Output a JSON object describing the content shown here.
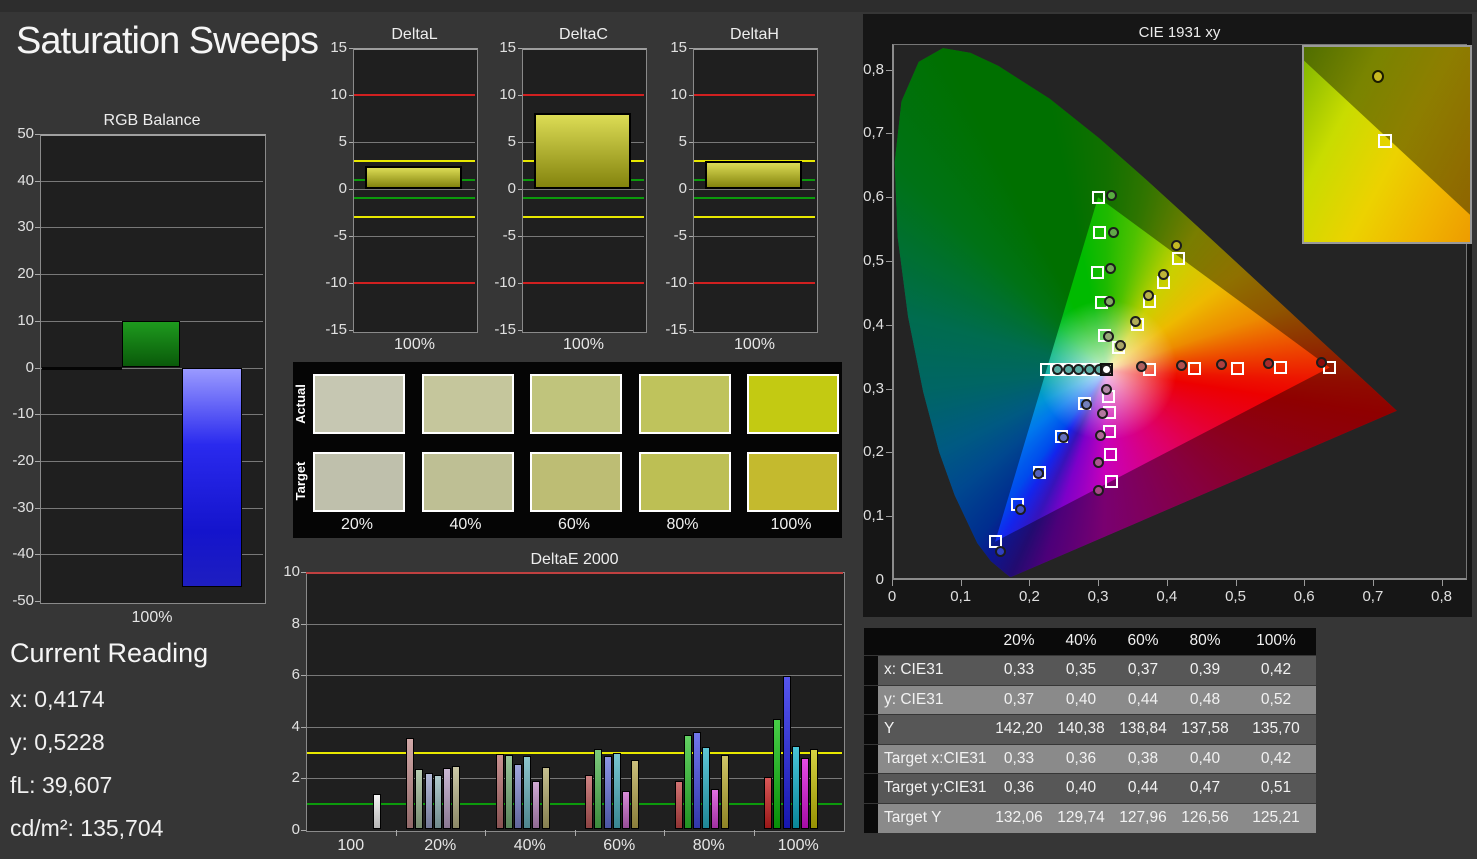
{
  "page": {
    "title": "Saturation Sweeps"
  },
  "current_reading": {
    "heading": "Current Reading",
    "values": [
      {
        "label": "x",
        "value": "0,4174"
      },
      {
        "label": "y",
        "value": "0,5228"
      },
      {
        "label": "fL",
        "value": "39,607"
      },
      {
        "label": "cd/m²",
        "value": "135,704"
      }
    ]
  },
  "chart_data": [
    {
      "id": "rgb_balance",
      "type": "bar",
      "title": "RGB Balance",
      "xlabel": "100%",
      "ylim": [
        -50,
        50
      ],
      "ytick_step": 10,
      "series": [
        {
          "name": "green",
          "value": 10
        },
        {
          "name": "blue",
          "value": -47
        }
      ]
    },
    {
      "id": "delta_l",
      "type": "bar",
      "title": "DeltaL",
      "xlabel": "100%",
      "ylim": [
        -15,
        15
      ],
      "value": 2.4,
      "limit_lines": {
        "red": 10,
        "yellow": 3,
        "green": 1
      }
    },
    {
      "id": "delta_c",
      "type": "bar",
      "title": "DeltaC",
      "xlabel": "100%",
      "ylim": [
        -15,
        15
      ],
      "value": 8.1,
      "limit_lines": {
        "red": 10,
        "yellow": 3,
        "green": 1
      }
    },
    {
      "id": "delta_h",
      "type": "bar",
      "title": "DeltaH",
      "xlabel": "100%",
      "ylim": [
        -15,
        15
      ],
      "value": 2.95,
      "limit_lines": {
        "red": 10,
        "yellow": 3,
        "green": 1
      }
    },
    {
      "id": "saturation_swatches",
      "type": "table",
      "row_labels": [
        "Actual",
        "Target"
      ],
      "columns": [
        "20%",
        "40%",
        "60%",
        "80%",
        "100%"
      ],
      "actual_colors": [
        "#c6c7b2",
        "#c5c69c",
        "#c0c47c",
        "#bfc35c",
        "#c3ca12"
      ],
      "target_colors": [
        "#bfc0ac",
        "#bebf94",
        "#bdbd74",
        "#bdbf54",
        "#c4ba2e"
      ]
    },
    {
      "id": "deltae_2000",
      "type": "bar",
      "title": "DeltaE 2000",
      "ylim": [
        0,
        10
      ],
      "limit_lines": {
        "red": 10,
        "yellow": 3,
        "green": 1
      },
      "groups": [
        {
          "label": "100",
          "bars": [
            {
              "name": "white",
              "value": 1.4,
              "color": "#f2f2f2"
            }
          ]
        },
        {
          "label": "20%",
          "bars": [
            {
              "name": "red",
              "value": 3.55,
              "color": "#c28c8c"
            },
            {
              "name": "green",
              "value": 2.35,
              "color": "#a0ba96"
            },
            {
              "name": "blue",
              "value": 2.2,
              "color": "#9aa2ca"
            },
            {
              "name": "cyan",
              "value": 2.15,
              "color": "#96b8bc"
            },
            {
              "name": "magenta",
              "value": 2.4,
              "color": "#b8a0c4"
            },
            {
              "name": "yellow",
              "value": 2.5,
              "color": "#bab688"
            }
          ]
        },
        {
          "label": "40%",
          "bars": [
            {
              "name": "red",
              "value": 2.95,
              "color": "#b66e6e"
            },
            {
              "name": "green",
              "value": 2.9,
              "color": "#78b078"
            },
            {
              "name": "blue",
              "value": 2.55,
              "color": "#8088d0"
            },
            {
              "name": "cyan",
              "value": 2.85,
              "color": "#68b2be"
            },
            {
              "name": "magenta",
              "value": 1.9,
              "color": "#c08cc4"
            },
            {
              "name": "yellow",
              "value": 2.45,
              "color": "#b2aa6a"
            }
          ]
        },
        {
          "label": "60%",
          "bars": [
            {
              "name": "red",
              "value": 2.15,
              "color": "#bc5a5a"
            },
            {
              "name": "green",
              "value": 3.15,
              "color": "#50b850"
            },
            {
              "name": "blue",
              "value": 2.85,
              "color": "#6472da"
            },
            {
              "name": "cyan",
              "value": 3.0,
              "color": "#4cb2c2"
            },
            {
              "name": "magenta",
              "value": 1.5,
              "color": "#ca66ca"
            },
            {
              "name": "yellow",
              "value": 2.7,
              "color": "#b8a84e"
            }
          ]
        },
        {
          "label": "80%",
          "bars": [
            {
              "name": "red",
              "value": 1.9,
              "color": "#c24444"
            },
            {
              "name": "green",
              "value": 3.7,
              "color": "#2ec22e"
            },
            {
              "name": "blue",
              "value": 3.8,
              "color": "#414ae4"
            },
            {
              "name": "cyan",
              "value": 3.2,
              "color": "#28b2c8"
            },
            {
              "name": "magenta",
              "value": 1.6,
              "color": "#d640d6"
            },
            {
              "name": "yellow",
              "value": 2.9,
              "color": "#beb032"
            }
          ]
        },
        {
          "label": "100%",
          "bars": [
            {
              "name": "red",
              "value": 2.05,
              "color": "#cc1f1f"
            },
            {
              "name": "green",
              "value": 4.3,
              "color": "#0abe0a"
            },
            {
              "name": "blue",
              "value": 5.95,
              "color": "#1d1de8"
            },
            {
              "name": "cyan",
              "value": 3.25,
              "color": "#0cb2cc"
            },
            {
              "name": "magenta",
              "value": 2.8,
              "color": "#dc10dc"
            },
            {
              "name": "yellow",
              "value": 3.15,
              "color": "#c8c203"
            }
          ]
        }
      ]
    },
    {
      "id": "cie_1931",
      "type": "scatter",
      "title": "CIE 1931 xy",
      "xticks": [
        "0",
        "0,1",
        "0,2",
        "0,3",
        "0,4",
        "0,5",
        "0,6",
        "0,7",
        "0,8"
      ],
      "yticks": [
        "0",
        "0,1",
        "0,2",
        "0,3",
        "0,4",
        "0,5",
        "0,6",
        "0,7",
        "0,8"
      ],
      "white_point": {
        "target": [
          0.3115,
          0.3305
        ],
        "measured": [
          0.3115,
          0.3315
        ]
      },
      "sweeps": [
        {
          "name": "red",
          "targets": [
            [
              0.375,
              0.33
            ],
            [
              0.44,
              0.331
            ],
            [
              0.503,
              0.332
            ],
            [
              0.566,
              0.333
            ],
            [
              0.637,
              0.333
            ]
          ],
          "measured": [
            [
              0.363,
              0.336
            ],
            [
              0.421,
              0.337
            ],
            [
              0.479,
              0.338
            ],
            [
              0.547,
              0.34
            ],
            [
              0.624,
              0.342
            ]
          ],
          "colors": [
            "#b06060",
            "#b05050",
            "#ac4040",
            "#a82a2a",
            "#8c0c0c"
          ]
        },
        {
          "name": "green",
          "targets": [
            [
              0.309,
              0.384
            ],
            [
              0.305,
              0.435
            ],
            [
              0.299,
              0.482
            ],
            [
              0.302,
              0.545
            ],
            [
              0.3,
              0.6
            ]
          ],
          "measured": [
            [
              0.315,
              0.383
            ],
            [
              0.316,
              0.437
            ],
            [
              0.317,
              0.489
            ],
            [
              0.321,
              0.545
            ],
            [
              0.319,
              0.604
            ]
          ],
          "colors": [
            "#96aa78",
            "#84a868",
            "#74a858",
            "#62a848",
            "#58ac40"
          ]
        },
        {
          "name": "blue",
          "targets": [
            [
              0.28,
              0.277
            ],
            [
              0.247,
              0.225
            ],
            [
              0.214,
              0.168
            ],
            [
              0.183,
              0.118
            ],
            [
              0.15,
              0.06
            ]
          ],
          "measured": [
            [
              0.282,
              0.276
            ],
            [
              0.249,
              0.224
            ],
            [
              0.213,
              0.167
            ],
            [
              0.186,
              0.112
            ],
            [
              0.157,
              0.046
            ]
          ],
          "colors": [
            "#7480bc",
            "#6470bc",
            "#5462c0",
            "#4452c4",
            "#3040c0"
          ]
        },
        {
          "name": "cyan",
          "targets": [
            [
              0.2925,
              0.33
            ],
            [
              0.275,
              0.33
            ],
            [
              0.2575,
              0.33
            ],
            [
              0.24,
              0.33
            ],
            [
              0.2255,
              0.33
            ]
          ],
          "measured": [
            [
              0.301,
              0.33
            ],
            [
              0.287,
              0.33
            ],
            [
              0.271,
              0.33
            ],
            [
              0.256,
              0.33
            ],
            [
              0.24,
              0.33
            ]
          ],
          "colors": [
            "#5aaca4",
            "#5aaca4",
            "#5aaca4",
            "#5aaca4",
            "#5aaca4"
          ]
        },
        {
          "name": "magenta",
          "targets": [
            [
              0.3145,
              0.2875
            ],
            [
              0.316,
              0.262
            ],
            [
              0.3165,
              0.232
            ],
            [
              0.318,
              0.196
            ],
            [
              0.32,
              0.154
            ]
          ],
          "measured": [
            [
              0.3115,
              0.3
            ],
            [
              0.306,
              0.262
            ],
            [
              0.303,
              0.228
            ],
            [
              0.3,
              0.185
            ],
            [
              0.3,
              0.141
            ]
          ],
          "colors": [
            "#b488a8",
            "#b478a0",
            "#b06898",
            "#ac5890",
            "#a84888"
          ]
        },
        {
          "name": "yellow",
          "targets": [
            [
              0.329,
              0.365
            ],
            [
              0.358,
              0.4
            ],
            [
              0.3755,
              0.436
            ],
            [
              0.3955,
              0.466
            ],
            [
              0.4165,
              0.504
            ]
          ],
          "measured": [
            [
              0.332,
              0.368
            ],
            [
              0.354,
              0.406
            ],
            [
              0.372,
              0.446
            ],
            [
              0.394,
              0.48
            ],
            [
              0.414,
              0.525
            ]
          ],
          "colors": [
            "#a8a468",
            "#b0ac58",
            "#b8b048",
            "#beb438",
            "#c4ba24"
          ]
        }
      ],
      "inset": {
        "measured_color": "#c8b820"
      }
    }
  ],
  "cie_table": {
    "columns": [
      "20%",
      "40%",
      "60%",
      "80%",
      "100%"
    ],
    "rows": [
      {
        "label": "x: CIE31",
        "values": [
          "0,33",
          "0,35",
          "0,37",
          "0,39",
          "0,42"
        ]
      },
      {
        "label": "y: CIE31",
        "values": [
          "0,37",
          "0,40",
          "0,44",
          "0,48",
          "0,52"
        ]
      },
      {
        "label": "Y",
        "values": [
          "142,20",
          "140,38",
          "138,84",
          "137,58",
          "135,70"
        ]
      },
      {
        "label": "Target x:CIE31",
        "values": [
          "0,33",
          "0,36",
          "0,38",
          "0,40",
          "0,42"
        ]
      },
      {
        "label": "Target y:CIE31",
        "values": [
          "0,36",
          "0,40",
          "0,44",
          "0,47",
          "0,51"
        ]
      },
      {
        "label": "Target Y",
        "values": [
          "132,06",
          "129,74",
          "127,96",
          "126,56",
          "125,21"
        ]
      }
    ]
  }
}
